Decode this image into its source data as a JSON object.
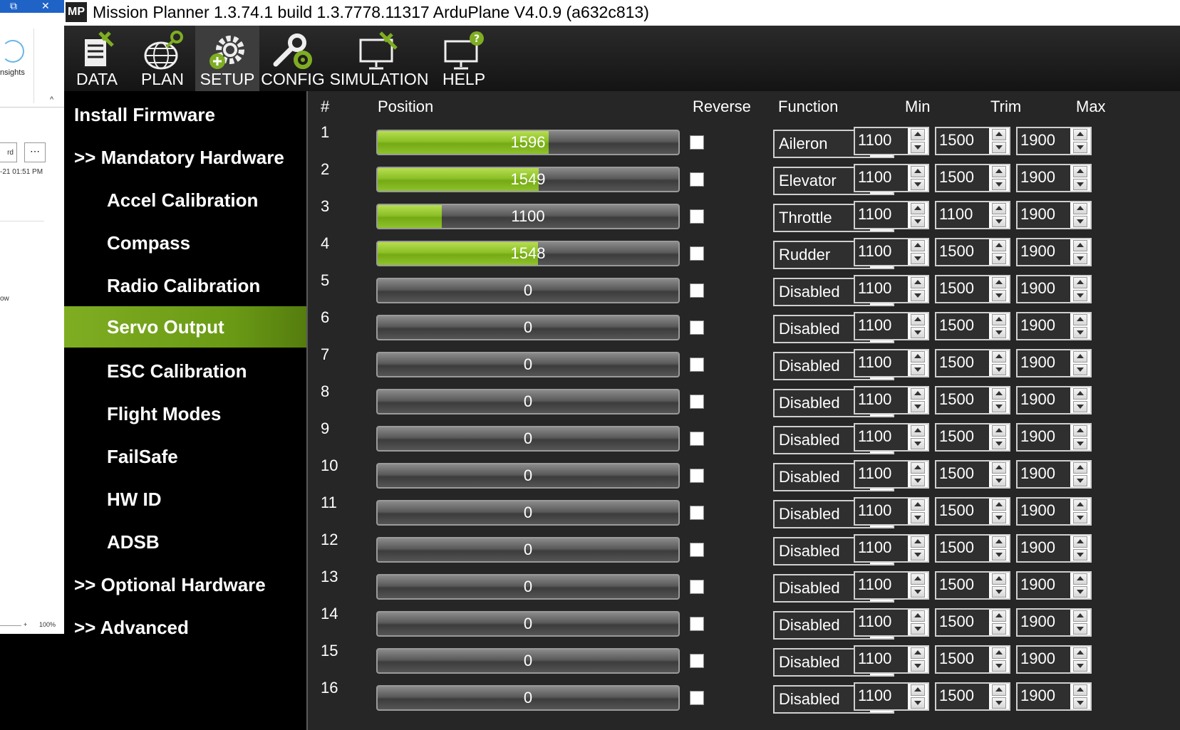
{
  "window": {
    "title": "Mission Planner 1.3.74.1 build 1.3.7778.11317 ArduPlane V4.0.9 (a632c813)",
    "icon_text": "MP"
  },
  "background_window": {
    "restore_glyph": "⧉",
    "close_glyph": "✕",
    "insights_label": "nsights",
    "caret": "^",
    "board_label": "rd",
    "more_glyph": "⋯",
    "date_label": "-21 01:51 PM",
    "ow_label": "ow",
    "zoom_plus": "+",
    "zoom_pct": "100%"
  },
  "toolbar": {
    "items": [
      {
        "label": "DATA"
      },
      {
        "label": "PLAN"
      },
      {
        "label": "SETUP"
      },
      {
        "label": "CONFIG"
      },
      {
        "label": "SIMULATION"
      },
      {
        "label": "HELP"
      }
    ],
    "active": "SETUP"
  },
  "sidebar": {
    "items": [
      {
        "label": "Install Firmware"
      },
      {
        "label": ">> Mandatory Hardware"
      },
      {
        "label": "Accel Calibration"
      },
      {
        "label": "Compass"
      },
      {
        "label": "Radio Calibration"
      },
      {
        "label": "Servo Output"
      },
      {
        "label": "ESC Calibration"
      },
      {
        "label": "Flight Modes"
      },
      {
        "label": "FailSafe"
      },
      {
        "label": "HW ID"
      },
      {
        "label": "ADSB"
      },
      {
        "label": ">> Optional Hardware"
      },
      {
        "label": ">> Advanced"
      }
    ],
    "active": "Servo Output"
  },
  "servo_table": {
    "headers": {
      "num": "#",
      "position": "Position",
      "reverse": "Reverse",
      "function": "Function",
      "min": "Min",
      "trim": "Trim",
      "max": "Max"
    },
    "bar_range": [
      800,
      2200
    ],
    "rows": [
      {
        "num": "1",
        "position": 1596,
        "position_label": "1596",
        "function": "Aileron",
        "min": "1100",
        "trim": "1500",
        "max": "1900"
      },
      {
        "num": "2",
        "position": 1549,
        "position_label": "1549",
        "function": "Elevator",
        "min": "1100",
        "trim": "1500",
        "max": "1900"
      },
      {
        "num": "3",
        "position": 1100,
        "position_label": "1100",
        "function": "Throttle",
        "min": "1100",
        "trim": "1100",
        "max": "1900"
      },
      {
        "num": "4",
        "position": 1548,
        "position_label": "1548",
        "function": "Rudder",
        "min": "1100",
        "trim": "1500",
        "max": "1900"
      },
      {
        "num": "5",
        "position": 0,
        "position_label": "0",
        "function": "Disabled",
        "min": "1100",
        "trim": "1500",
        "max": "1900"
      },
      {
        "num": "6",
        "position": 0,
        "position_label": "0",
        "function": "Disabled",
        "min": "1100",
        "trim": "1500",
        "max": "1900"
      },
      {
        "num": "7",
        "position": 0,
        "position_label": "0",
        "function": "Disabled",
        "min": "1100",
        "trim": "1500",
        "max": "1900"
      },
      {
        "num": "8",
        "position": 0,
        "position_label": "0",
        "function": "Disabled",
        "min": "1100",
        "trim": "1500",
        "max": "1900"
      },
      {
        "num": "9",
        "position": 0,
        "position_label": "0",
        "function": "Disabled",
        "min": "1100",
        "trim": "1500",
        "max": "1900"
      },
      {
        "num": "10",
        "position": 0,
        "position_label": "0",
        "function": "Disabled",
        "min": "1100",
        "trim": "1500",
        "max": "1900"
      },
      {
        "num": "11",
        "position": 0,
        "position_label": "0",
        "function": "Disabled",
        "min": "1100",
        "trim": "1500",
        "max": "1900"
      },
      {
        "num": "12",
        "position": 0,
        "position_label": "0",
        "function": "Disabled",
        "min": "1100",
        "trim": "1500",
        "max": "1900"
      },
      {
        "num": "13",
        "position": 0,
        "position_label": "0",
        "function": "Disabled",
        "min": "1100",
        "trim": "1500",
        "max": "1900"
      },
      {
        "num": "14",
        "position": 0,
        "position_label": "0",
        "function": "Disabled",
        "min": "1100",
        "trim": "1500",
        "max": "1900"
      },
      {
        "num": "15",
        "position": 0,
        "position_label": "0",
        "function": "Disabled",
        "min": "1100",
        "trim": "1500",
        "max": "1900"
      },
      {
        "num": "16",
        "position": 0,
        "position_label": "0",
        "function": "Disabled",
        "min": "1100",
        "trim": "1500",
        "max": "1900"
      }
    ]
  },
  "colors": {
    "accent_green": "#7fad22",
    "bar_fill": "#8cc028",
    "panel_bg": "#262626"
  },
  "icons": {
    "toolbar": [
      "data-icon",
      "plan-globe-icon",
      "setup-gear-icon",
      "config-wrench-icon",
      "simulation-monitor-icon",
      "help-monitor-icon"
    ]
  }
}
